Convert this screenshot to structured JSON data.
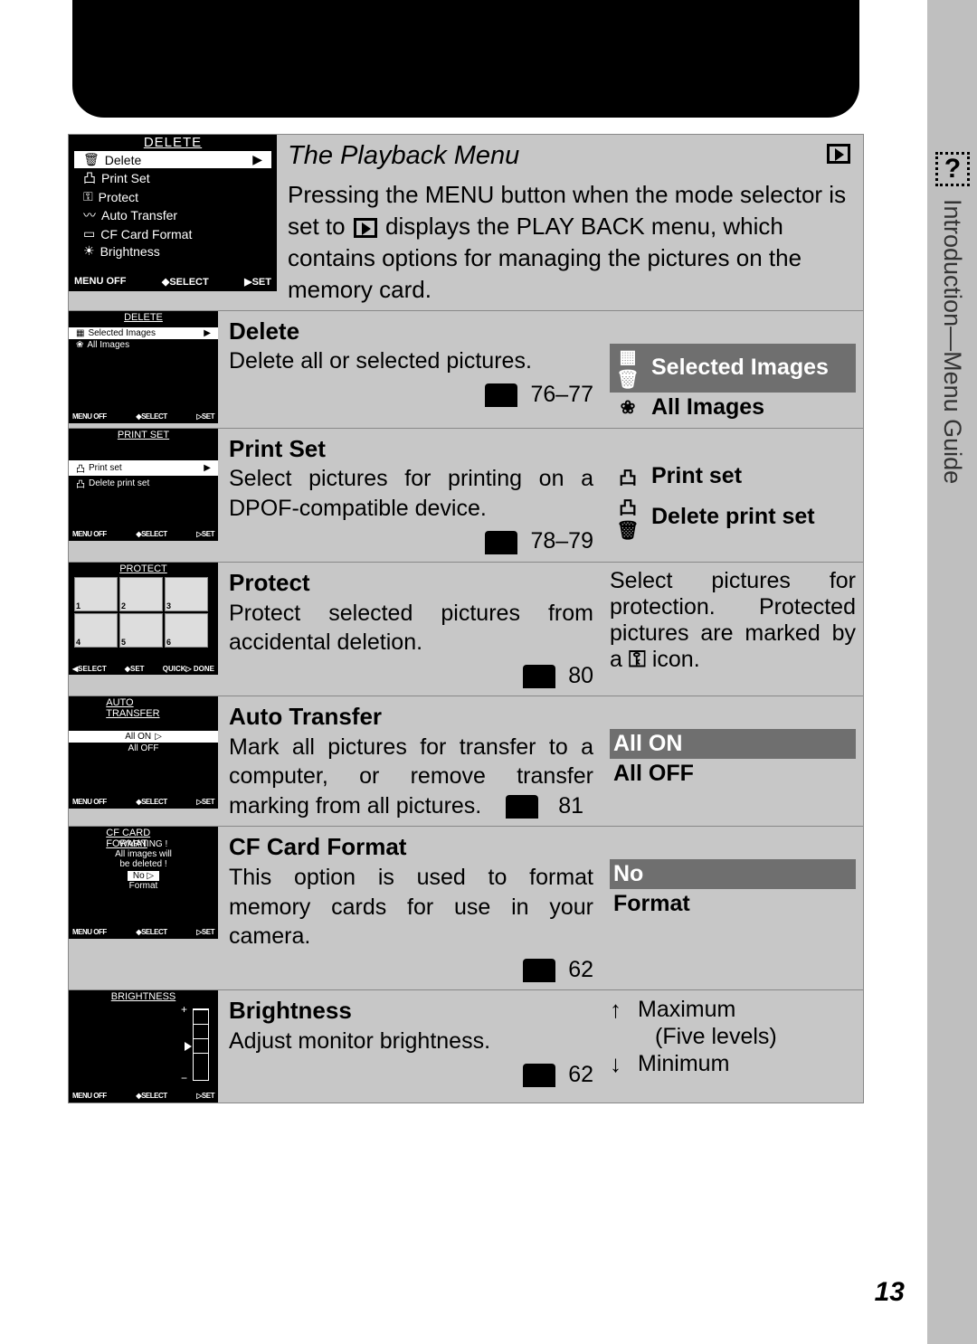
{
  "page_number": "13",
  "side_tab": "Introduction—Menu Guide",
  "intro": {
    "title": "The Playback Menu",
    "body_pre": "Pressing the MENU button when the mode selector is set to ",
    "body_post": " displays the PLAY BACK menu, which contains options for managing the pictures on the memory card.",
    "thumb_title": "DELETE",
    "thumb_items": [
      "Delete",
      "Print Set",
      "Protect",
      "Auto Transfer",
      "CF Card Format",
      "Brightness"
    ],
    "nav": {
      "off": "MENU OFF",
      "sel": "◆SELECT",
      "set": "▶SET"
    }
  },
  "sections": [
    {
      "title": "Delete",
      "desc": "Delete all or selected pictures.",
      "pages": "76–77",
      "thumb_title": "DELETE",
      "thumb_items": [
        "Selected Images",
        "All Images"
      ],
      "options": [
        {
          "hl": true,
          "label": "Selected Images",
          "icon": "▦"
        },
        {
          "hl": false,
          "label": "All Images",
          "icon": "❀"
        }
      ]
    },
    {
      "title": "Print Set",
      "desc": "Select pictures for printing on a DPOF-compatible device.",
      "pages": "78–79",
      "thumb_title": "PRINT SET",
      "thumb_items": [
        "Print set",
        "Delete print set"
      ],
      "options": [
        {
          "hl": false,
          "label": "Print set",
          "icon": "凸"
        },
        {
          "hl": false,
          "label": "Delete print set",
          "icon": "凸"
        }
      ]
    },
    {
      "title": "Protect",
      "desc": "Protect selected pictures from accidental deletion.",
      "pages": "80",
      "thumb_title": "PROTECT",
      "right_text_pre": "Select pictures for protection. Protected pictures are marked by a ",
      "right_text_post": " icon.",
      "key_icon": "⚿"
    },
    {
      "title": "Auto Transfer",
      "desc": "Mark all pictures for transfer to a computer, or remove transfer marking from all pictures.",
      "pages": "81",
      "thumb_title": "AUTO TRANSFER",
      "thumb_items": [
        "All ON",
        "All OFF"
      ],
      "options": [
        {
          "hl": true,
          "label": "All ON",
          "icon": ""
        },
        {
          "hl": false,
          "label": "All OFF",
          "icon": ""
        }
      ]
    },
    {
      "title": "CF Card Format",
      "desc": "This option is used to format memory cards for use in your camera.",
      "pages": "62",
      "thumb_title": "CF CARD FORMAT",
      "warn_lines": [
        "WARNING !",
        "All images will",
        "be deleted !",
        "No   ▷",
        "Format"
      ],
      "options": [
        {
          "hl": true,
          "label": "No",
          "icon": ""
        },
        {
          "hl": false,
          "label": "Format",
          "icon": ""
        }
      ]
    },
    {
      "title": "Brightness",
      "desc": "Adjust monitor brightness.",
      "pages": "62",
      "thumb_title": "BRIGHTNESS",
      "right_max": "Maximum",
      "right_mid": "(Five levels)",
      "right_min": "Minimum"
    }
  ],
  "thumb_nav": {
    "off": "MENU OFF",
    "sel": "◆SELECT",
    "set": "▷SET"
  },
  "protect_nav": {
    "a": "◀SELECT",
    "b": "◆SET",
    "c": "QUICK▷ DONE"
  }
}
